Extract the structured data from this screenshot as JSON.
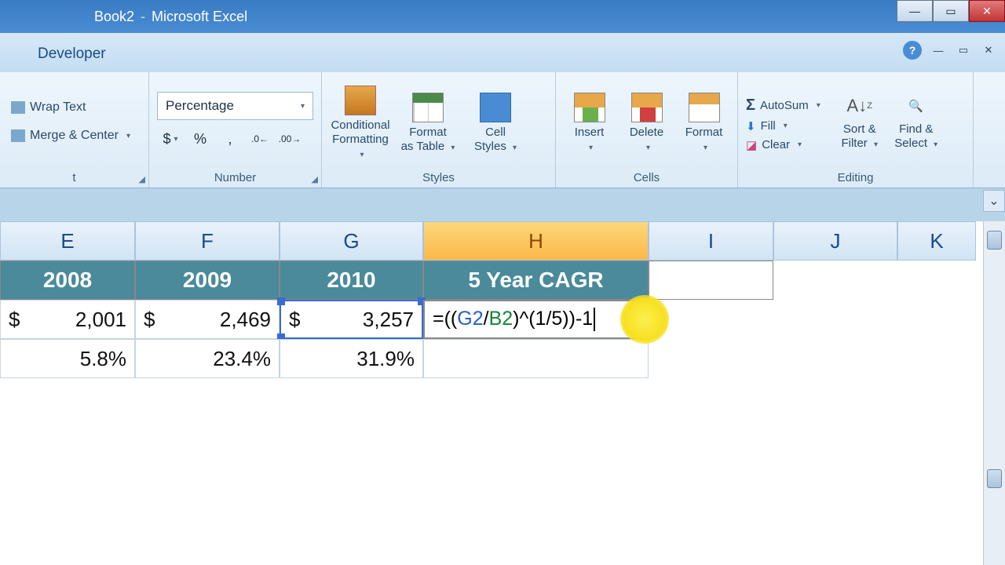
{
  "window": {
    "doc": "Book2",
    "app": "Microsoft Excel"
  },
  "tabs": {
    "developer": "Developer"
  },
  "ribbon": {
    "alignment": {
      "wrap": "Wrap Text",
      "merge": "Merge & Center",
      "label_suffix": "t"
    },
    "number": {
      "format": "Percentage",
      "dollar": "$",
      "percent": "%",
      "comma": ",",
      "label": "Number"
    },
    "styles": {
      "conditional_l1": "Conditional",
      "conditional_l2": "Formatting",
      "table_l1": "Format",
      "table_l2": "as Table",
      "cellstyles_l1": "Cell",
      "cellstyles_l2": "Styles",
      "label": "Styles"
    },
    "cells": {
      "insert": "Insert",
      "delete": "Delete",
      "format": "Format",
      "label": "Cells"
    },
    "editing": {
      "autosum": "AutoSum",
      "fill": "Fill",
      "clear": "Clear",
      "sort_l1": "Sort &",
      "sort_l2": "Filter",
      "find_l1": "Find &",
      "find_l2": "Select",
      "label": "Editing"
    }
  },
  "columns": {
    "E": "E",
    "F": "F",
    "G": "G",
    "H": "H",
    "I": "I",
    "J": "J",
    "K": "K"
  },
  "headers": {
    "E": "2008",
    "F": "2009",
    "G": "2010",
    "H": "5 Year CAGR"
  },
  "row2": {
    "E_sym": "$",
    "E_val": "2,001",
    "F_sym": "$",
    "F_val": "2,469",
    "G_sym": "$",
    "G_val": "3,257"
  },
  "row3": {
    "E": "5.8%",
    "F": "23.4%",
    "G": "31.9%"
  },
  "formula": {
    "pre": "=((",
    "ref1": "G2",
    "slash": "/",
    "ref2": "B2",
    "mid": ")^(1/5)",
    "close": ")",
    "tail": "-1"
  }
}
